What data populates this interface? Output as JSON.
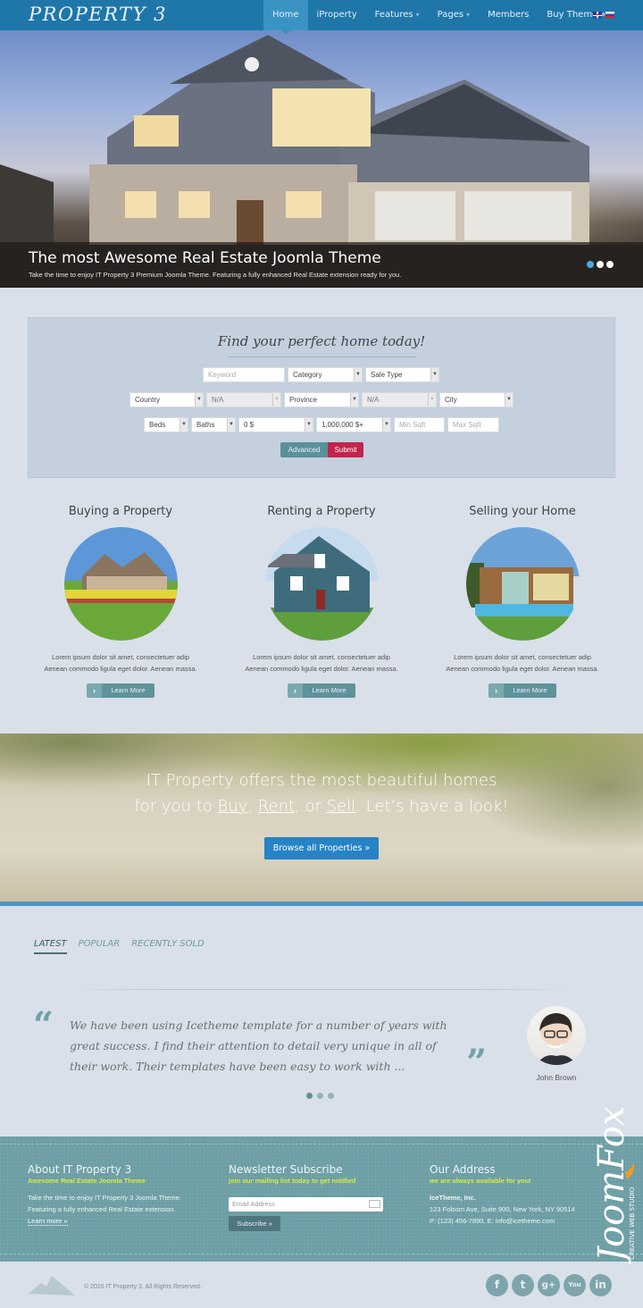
{
  "header": {
    "logo": "PROPERTY 3",
    "nav": [
      {
        "label": "Home",
        "active": true
      },
      {
        "label": "iProperty"
      },
      {
        "label": "Features",
        "dropdown": true
      },
      {
        "label": "Pages",
        "dropdown": true
      },
      {
        "label": "Members"
      },
      {
        "label": "Buy Theme »"
      }
    ],
    "languages": [
      "English",
      "Russian"
    ]
  },
  "hero": {
    "title": "The most Awesome Real Estate Joomla Theme",
    "subtitle": "Take the time to enjoy IT Property 3 Premium Joomla Theme. Featuring a fully enhanced Real Estate extension ready for you.",
    "slides": 3,
    "active_slide": 1
  },
  "search": {
    "title": "Find your perfect home today!",
    "keyword_placeholder": "Keyword",
    "category": "Category",
    "sale_type": "Sale Type",
    "country": "Country",
    "state": "N/A",
    "province": "Province",
    "county": "N/A",
    "city": "City",
    "beds": "Beds",
    "baths": "Baths",
    "price_min": "0 $",
    "price_max": "1,000,000 $+",
    "min_sqft_placeholder": "Min Sqft",
    "max_sqft_placeholder": "Max Sqft",
    "advanced_label": "Advanced",
    "submit_label": "Submit"
  },
  "features": [
    {
      "title": "Buying a Property",
      "text1": "Lorem ipsum dolor sit amet, consectetuer adip",
      "text2": "Aenean commodo ligula eget dolor. Aenean massa.",
      "button": "Learn More"
    },
    {
      "title": "Renting a Property",
      "text1": "Lorem ipsum dolor sit amet, consectetuer adip",
      "text2": "Aenean commodo ligula eget dolor. Aenean massa.",
      "button": "Learn More"
    },
    {
      "title": "Selling your Home",
      "text1": "Lorem ipsum dolor sit amet, consectetuer adip",
      "text2": "Aenean commodo ligula eget dolor. Aenean massa.",
      "button": "Learn More"
    }
  ],
  "banner": {
    "line1": "IT Property offers the most beautiful homes",
    "line2_pre": "for you to ",
    "buy": "Buy",
    "comma1": ", ",
    "rent": "Rent",
    "comma2": ", or ",
    "sell": "Sell",
    "line2_post": ". Let’s have a look!",
    "button": "Browse all Properties »"
  },
  "tabs": [
    {
      "label": "LATEST",
      "active": true
    },
    {
      "label": "POPULAR"
    },
    {
      "label": "RECENTLY SOLD"
    }
  ],
  "testimonial": {
    "quote": "We have been using Icetheme template for a number of years with great success. I find their attention to detail very unique in all of their work. Their templates have been easy to work with ...",
    "author": "John Brown",
    "slides": 3,
    "active_slide": 1
  },
  "footer": {
    "about": {
      "title": "About IT Property 3",
      "subtitle": "Awesome Real Estate Joomla Theme",
      "line1": "Take the time to enjoy IT Property 3 Joomla Theme.",
      "line2": "Featuring a fully enhanced Real Estate extension.",
      "link": "Learn more »"
    },
    "newsletter": {
      "title": "Newsletter Subscribe",
      "subtitle": "join our mailing list today to get notified",
      "email_placeholder": "Email Address",
      "button": "Subscribe »"
    },
    "address": {
      "title": "Our Address",
      "subtitle": "we are always available for you!",
      "company": "IceTheme, Inc.",
      "street": "123 Folsom Ave, Suite 900, New York, NY 90514",
      "contact": "P: (123) 456-7890, E: info@icetheme.com"
    },
    "brand": {
      "name": "JoomFox",
      "tagline": "CREATIVE WEB STUDIO"
    }
  },
  "bottom": {
    "copyright": "© 2015 IT Property 3. All Rights Reserved.",
    "social": [
      {
        "name": "facebook",
        "glyph": "f"
      },
      {
        "name": "twitter",
        "glyph": "t"
      },
      {
        "name": "google-plus",
        "glyph": "g+"
      },
      {
        "name": "youtube",
        "glyph": "You"
      },
      {
        "name": "linkedin",
        "glyph": "in"
      }
    ]
  },
  "colors": {
    "header": "#1f76a9",
    "nav_active": "#3a93c3",
    "submit": "#c2244c",
    "advanced": "#5a9199",
    "browse": "#2683c6",
    "footer": "#6c9ea4",
    "footer_accent": "#d8ec3a"
  }
}
